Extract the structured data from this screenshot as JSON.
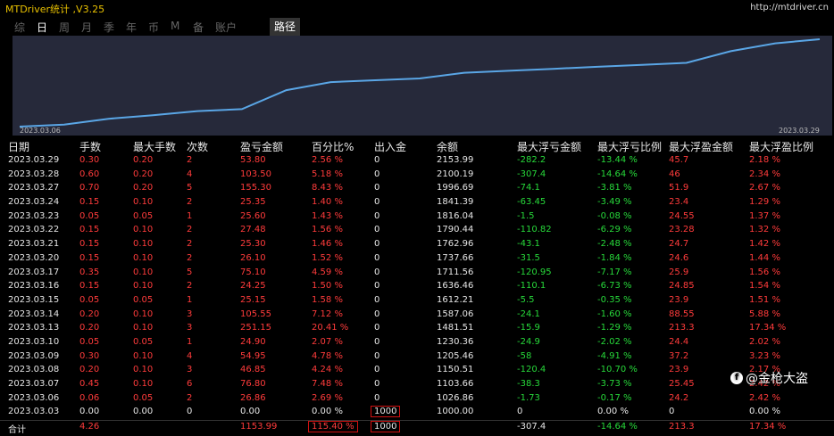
{
  "window": {
    "title": "MTDriver统计 ,V3.25",
    "url": "http://mtdriver.cn"
  },
  "tabs": [
    {
      "label": "综",
      "active": false
    },
    {
      "label": "日",
      "active": true
    },
    {
      "label": "周",
      "active": false
    },
    {
      "label": "月",
      "active": false
    },
    {
      "label": "季",
      "active": false
    },
    {
      "label": "年",
      "active": false
    },
    {
      "label": "币",
      "active": false
    },
    {
      "label": "M",
      "active": false
    },
    {
      "label": "备",
      "active": false
    },
    {
      "label": "账户",
      "active": false
    }
  ],
  "route_button": "路径",
  "chart": {
    "start_date": "2023.03.06",
    "end_date": "2023.03.29",
    "line_color": "#5aa6e6",
    "background": "#26293a"
  },
  "table": {
    "headers": {
      "date": "日期",
      "hand": "手数",
      "max_hand": "最大手数",
      "count": "次数",
      "pnl": "盈亏金额",
      "pct": "百分比%",
      "io": "出入金",
      "balance": "余额",
      "max_float_loss": "最大浮亏金额",
      "max_float_loss_pct": "最大浮亏比例",
      "max_float_profit": "最大浮盈金额",
      "max_float_profit_pct": "最大浮盈比例"
    },
    "rows": [
      {
        "date": "2023.03.29",
        "hand": "0.30",
        "max_hand": "0.20",
        "count": "2",
        "pnl": "53.80",
        "pct": "2.56 %",
        "io": "0",
        "balance": "2153.99",
        "fla": "-282.2",
        "flr": "-13.44 %",
        "fpa": "45.7",
        "fpr": "2.18 %"
      },
      {
        "date": "2023.03.28",
        "hand": "0.60",
        "max_hand": "0.20",
        "count": "4",
        "pnl": "103.50",
        "pct": "5.18 %",
        "io": "0",
        "balance": "2100.19",
        "fla": "-307.4",
        "flr": "-14.64 %",
        "fpa": "46",
        "fpr": "2.34 %"
      },
      {
        "date": "2023.03.27",
        "hand": "0.70",
        "max_hand": "0.20",
        "count": "5",
        "pnl": "155.30",
        "pct": "8.43 %",
        "io": "0",
        "balance": "1996.69",
        "fla": "-74.1",
        "flr": "-3.81 %",
        "fpa": "51.9",
        "fpr": "2.67 %"
      },
      {
        "date": "2023.03.24",
        "hand": "0.15",
        "max_hand": "0.10",
        "count": "2",
        "pnl": "25.35",
        "pct": "1.40 %",
        "io": "0",
        "balance": "1841.39",
        "fla": "-63.45",
        "flr": "-3.49 %",
        "fpa": "23.4",
        "fpr": "1.29 %"
      },
      {
        "date": "2023.03.23",
        "hand": "0.05",
        "max_hand": "0.05",
        "count": "1",
        "pnl": "25.60",
        "pct": "1.43 %",
        "io": "0",
        "balance": "1816.04",
        "fla": "-1.5",
        "flr": "-0.08 %",
        "fpa": "24.55",
        "fpr": "1.37 %"
      },
      {
        "date": "2023.03.22",
        "hand": "0.15",
        "max_hand": "0.10",
        "count": "2",
        "pnl": "27.48",
        "pct": "1.56 %",
        "io": "0",
        "balance": "1790.44",
        "fla": "-110.82",
        "flr": "-6.29 %",
        "fpa": "23.28",
        "fpr": "1.32 %"
      },
      {
        "date": "2023.03.21",
        "hand": "0.15",
        "max_hand": "0.10",
        "count": "2",
        "pnl": "25.30",
        "pct": "1.46 %",
        "io": "0",
        "balance": "1762.96",
        "fla": "-43.1",
        "flr": "-2.48 %",
        "fpa": "24.7",
        "fpr": "1.42 %"
      },
      {
        "date": "2023.03.20",
        "hand": "0.15",
        "max_hand": "0.10",
        "count": "2",
        "pnl": "26.10",
        "pct": "1.52 %",
        "io": "0",
        "balance": "1737.66",
        "fla": "-31.5",
        "flr": "-1.84 %",
        "fpa": "24.6",
        "fpr": "1.44 %"
      },
      {
        "date": "2023.03.17",
        "hand": "0.35",
        "max_hand": "0.10",
        "count": "5",
        "pnl": "75.10",
        "pct": "4.59 %",
        "io": "0",
        "balance": "1711.56",
        "fla": "-120.95",
        "flr": "-7.17 %",
        "fpa": "25.9",
        "fpr": "1.56 %"
      },
      {
        "date": "2023.03.16",
        "hand": "0.15",
        "max_hand": "0.10",
        "count": "2",
        "pnl": "24.25",
        "pct": "1.50 %",
        "io": "0",
        "balance": "1636.46",
        "fla": "-110.1",
        "flr": "-6.73 %",
        "fpa": "24.85",
        "fpr": "1.54 %"
      },
      {
        "date": "2023.03.15",
        "hand": "0.05",
        "max_hand": "0.05",
        "count": "1",
        "pnl": "25.15",
        "pct": "1.58 %",
        "io": "0",
        "balance": "1612.21",
        "fla": "-5.5",
        "flr": "-0.35 %",
        "fpa": "23.9",
        "fpr": "1.51 %"
      },
      {
        "date": "2023.03.14",
        "hand": "0.20",
        "max_hand": "0.10",
        "count": "3",
        "pnl": "105.55",
        "pct": "7.12 %",
        "io": "0",
        "balance": "1587.06",
        "fla": "-24.1",
        "flr": "-1.60 %",
        "fpa": "88.55",
        "fpr": "5.88 %"
      },
      {
        "date": "2023.03.13",
        "hand": "0.20",
        "max_hand": "0.10",
        "count": "3",
        "pnl": "251.15",
        "pct": "20.41 %",
        "io": "0",
        "balance": "1481.51",
        "fla": "-15.9",
        "flr": "-1.29 %",
        "fpa": "213.3",
        "fpr": "17.34 %"
      },
      {
        "date": "2023.03.10",
        "hand": "0.05",
        "max_hand": "0.05",
        "count": "1",
        "pnl": "24.90",
        "pct": "2.07 %",
        "io": "0",
        "balance": "1230.36",
        "fla": "-24.9",
        "flr": "-2.02 %",
        "fpa": "24.4",
        "fpr": "2.02 %"
      },
      {
        "date": "2023.03.09",
        "hand": "0.30",
        "max_hand": "0.10",
        "count": "4",
        "pnl": "54.95",
        "pct": "4.78 %",
        "io": "0",
        "balance": "1205.46",
        "fla": "-58",
        "flr": "-4.91 %",
        "fpa": "37.2",
        "fpr": "3.23 %"
      },
      {
        "date": "2023.03.08",
        "hand": "0.20",
        "max_hand": "0.10",
        "count": "3",
        "pnl": "46.85",
        "pct": "4.24 %",
        "io": "0",
        "balance": "1150.51",
        "fla": "-120.4",
        "flr": "-10.70 %",
        "fpa": "23.9",
        "fpr": "2.17 %"
      },
      {
        "date": "2023.03.07",
        "hand": "0.45",
        "max_hand": "0.10",
        "count": "6",
        "pnl": "76.80",
        "pct": "7.48 %",
        "io": "0",
        "balance": "1103.66",
        "fla": "-38.3",
        "flr": "-3.73 %",
        "fpa": "25.45",
        "fpr": "2.42 %"
      },
      {
        "date": "2023.03.06",
        "hand": "0.06",
        "max_hand": "0.05",
        "count": "2",
        "pnl": "26.86",
        "pct": "2.69 %",
        "io": "0",
        "balance": "1026.86",
        "fla": "-1.73",
        "flr": "-0.17 %",
        "fpa": "24.2",
        "fpr": "2.42 %"
      },
      {
        "date": "2023.03.03",
        "hand": "0.00",
        "max_hand": "0.00",
        "count": "0",
        "pnl": "0.00",
        "pct": "0.00 %",
        "io": "1000",
        "balance": "1000.00",
        "fla": "0",
        "flr": "0.00 %",
        "fpa": "0",
        "fpr": "0.00 %"
      }
    ],
    "total": {
      "label": "合计",
      "hand": "4.26",
      "pnl": "1153.99",
      "pct": "115.40 %",
      "io": "1000",
      "fla": "-307.4",
      "flr": "-14.64 %",
      "fpa": "213.3",
      "fpr": "17.34 %"
    }
  },
  "watermark": "@金枪大盗"
}
